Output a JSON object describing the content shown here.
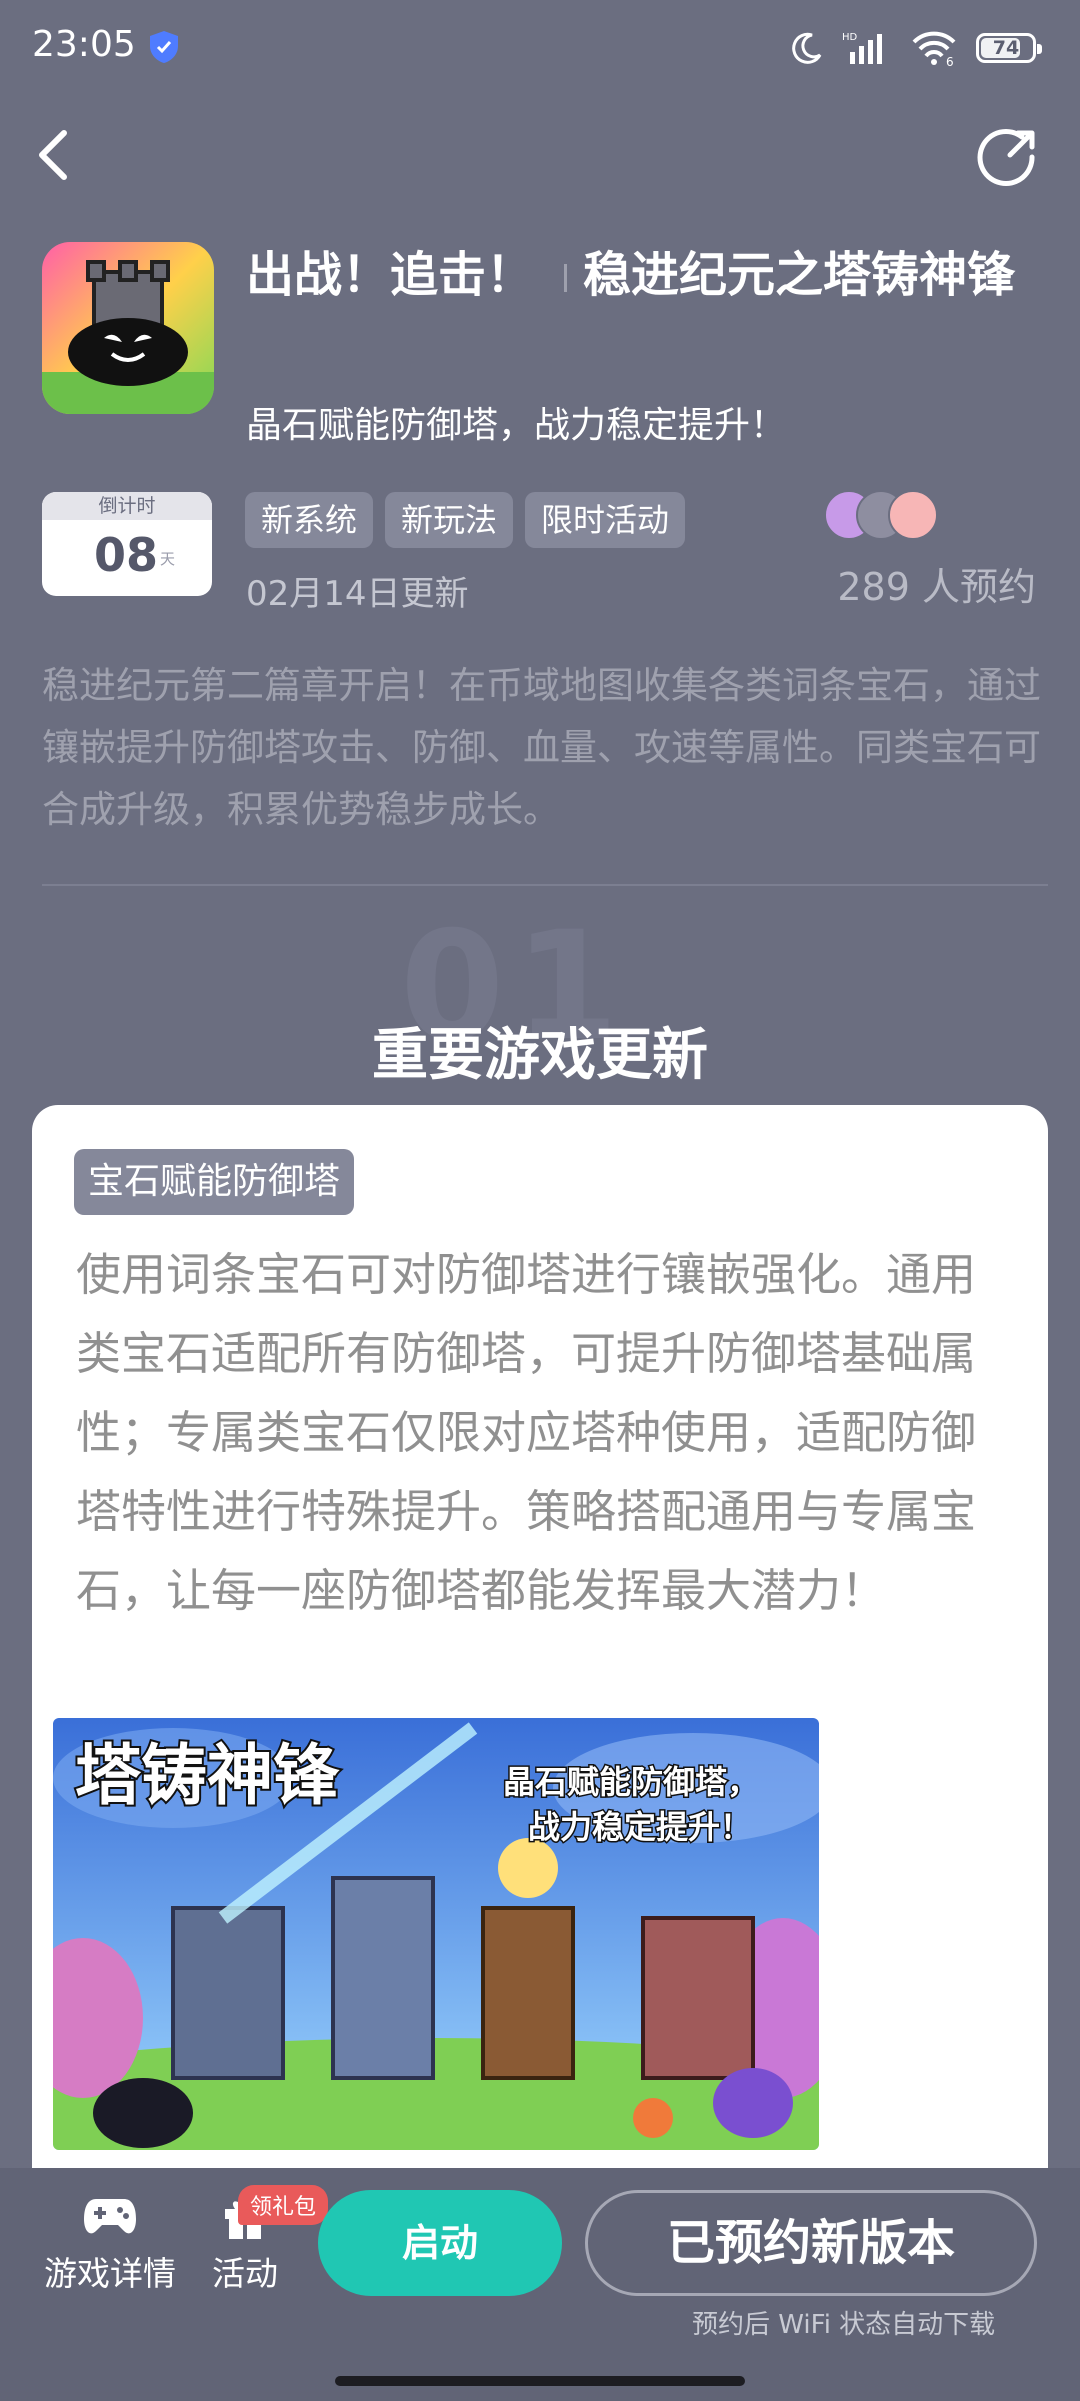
{
  "status_bar": {
    "time": "23:05",
    "battery": "74",
    "icons": [
      "moon-icon",
      "hd-signal-icon",
      "wifi-icon",
      "battery-icon"
    ]
  },
  "nav": {
    "back_icon": "chevron-left-icon",
    "share_icon": "share-icon"
  },
  "header": {
    "title_part1": "出战！追击！",
    "title_part2": "稳进纪元之塔铸神锋",
    "subtitle": "晶石赋能防御塔，战力稳定提升！",
    "countdown_label": "倒计时",
    "countdown_value": "08",
    "countdown_unit": "天",
    "tags": [
      "新系统",
      "新玩法",
      "限时活动"
    ],
    "update_date": "02月14日更新",
    "reserve_count": "289 人预约"
  },
  "description": "稳进纪元第二篇章开启！在币域地图收集各类词条宝石，通过镶嵌提升防御塔攻击、防御、血量、攻速等属性。同类宝石可合成升级，积累优势稳步成长。",
  "section": {
    "number": "01",
    "title": "重要游戏更新"
  },
  "card": {
    "tag": "宝石赋能防御塔",
    "body": "使用词条宝石可对防御塔进行镶嵌强化。通用类宝石适配所有防御塔，可提升防御塔基础属性；专属类宝石仅限对应塔种使用，适配防御塔特性进行特殊提升。策略搭配通用与专属宝石，让每一座防御塔都能发挥最大潜力！",
    "banner_title": "塔铸神锋",
    "banner_slogan_1": "晶石赋能防御塔，",
    "banner_slogan_2": "战力稳定提升！"
  },
  "bottom_bar": {
    "game_details": "游戏详情",
    "activity": "活动",
    "gift_badge": "领礼包",
    "launch": "启动",
    "reserved": "已预约新版本",
    "reserved_note": "预约后 WiFi 状态自动下载"
  },
  "colors": {
    "background": "#6b6e80",
    "accent": "#20c7b3",
    "tag": "#85889a",
    "badge": "#e95a5a"
  }
}
